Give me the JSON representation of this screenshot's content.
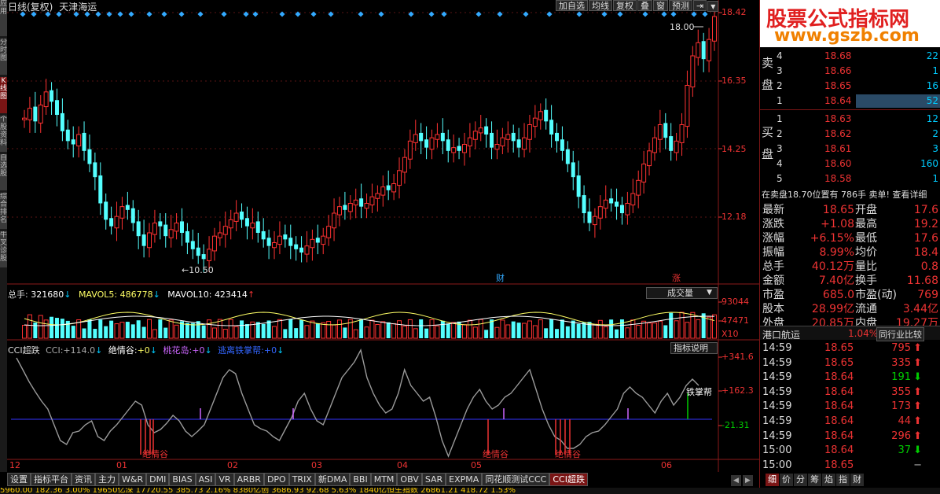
{
  "header": {
    "period": "日线(复权)",
    "stock": "天津海运"
  },
  "toolbar": [
    {
      "label": "加自选"
    },
    {
      "label": "均线"
    },
    {
      "label": "复权"
    },
    {
      "label": "叠"
    },
    {
      "label": "窗"
    },
    {
      "label": "预测"
    }
  ],
  "price_axis": [
    "18.42",
    "16.35",
    "14.25",
    "12.18"
  ],
  "annotations": {
    "high": "18.00",
    "low": "10.50",
    "cai": "财",
    "zhang": "涨"
  },
  "volume": {
    "label_total": "总手:",
    "total": "321680",
    "label_ma5": "MAVOL5:",
    "ma5": "486778",
    "label_ma10": "MAVOL10:",
    "ma10": "423414",
    "dropdown": "成交量",
    "axis_top": "93044",
    "axis_mid": "47471",
    "axis_unit": "X10"
  },
  "cci": {
    "name": "CCI超跌",
    "cci_label": "CCI:",
    "cci_val": "+114.0",
    "jqg_label": "绝情谷:",
    "jqg_val": "+0",
    "thd_label": "桃花岛:",
    "thd_val": "+0",
    "tlz_label": "逃离铁掌帮:",
    "tlz_val": "+0",
    "help_btn": "指标说明",
    "axis": [
      "+341.6",
      "+162.3",
      "-21.31"
    ],
    "marker_tzb": "铁掌帮",
    "marker_jqg": "绝情谷",
    "marker_jqg2": "绝情谷"
  },
  "dates": [
    "12",
    "01",
    "02",
    "03",
    "04",
    "05",
    "06"
  ],
  "bottom_tabs": [
    "设置",
    "指标平台",
    "资讯",
    "主力",
    "W&R",
    "DMI",
    "BIAS",
    "ASI",
    "VR",
    "ARBR",
    "DPO",
    "TRIX",
    "新DMA",
    "BBI",
    "MTM",
    "OBV",
    "SAR",
    "EXPMA",
    "同花顺测试CCC",
    "CCI超跌"
  ],
  "status_bar": "5960.00  182.36  3.00%  19650亿深  17720.55  385.73  2.16%  8380亿创  3686.93  92.68  5.63%  1840亿恒生指数  26861.21  418.72  1.53%",
  "right": {
    "banner": {
      "title": "股票公式指标网",
      "url": "www.gszb.com"
    },
    "sell_label": "卖盘",
    "buy_label": "买盘",
    "sell": [
      {
        "n": "4",
        "p": "18.68",
        "v": "22"
      },
      {
        "n": "3",
        "p": "18.66",
        "v": "1"
      },
      {
        "n": "2",
        "p": "18.65",
        "v": "16"
      },
      {
        "n": "1",
        "p": "18.64",
        "v": "52"
      }
    ],
    "buy": [
      {
        "n": "1",
        "p": "18.63",
        "v": "12"
      },
      {
        "n": "2",
        "p": "18.62",
        "v": "2"
      },
      {
        "n": "3",
        "p": "18.61",
        "v": "3"
      },
      {
        "n": "4",
        "p": "18.60",
        "v": "160"
      },
      {
        "n": "5",
        "p": "18.58",
        "v": "1"
      }
    ],
    "ticker": "在卖盘18.70位置有  786手  卖单! 查看详细",
    "stats": [
      {
        "k1": "最新",
        "v1": "18.65",
        "k2": "开盘",
        "v2": "17.6"
      },
      {
        "k1": "涨跌",
        "v1": "+1.08",
        "k2": "最高",
        "v2": "19.2"
      },
      {
        "k1": "涨幅",
        "v1": "+6.15%",
        "k2": "最低",
        "v2": "17.6"
      },
      {
        "k1": "振幅",
        "v1": "8.99%",
        "k2": "均价",
        "v2": "18.4"
      },
      {
        "k1": "总手",
        "v1": "40.12万",
        "k2": "量比",
        "v2": "0.8"
      },
      {
        "k1": "金额",
        "v1": "7.40亿",
        "k2": "换手",
        "v2": "11.68"
      },
      {
        "k1": "市盈",
        "v1": "685.0",
        "k2": "市盈(动)",
        "v2": "769"
      },
      {
        "k1": "股本",
        "v1": "28.99亿",
        "k2": "流通",
        "v2": "3.44亿"
      },
      {
        "k1": "外盘",
        "v1": "20.85万",
        "k2": "内盘",
        "v2": "19.27万"
      }
    ],
    "section": {
      "name": "港口航运",
      "pct": "1.04%",
      "btn": "同行业比较"
    },
    "ticks": [
      {
        "t": "14:59",
        "p": "18.65",
        "v": "795",
        "d": "up"
      },
      {
        "t": "14:59",
        "p": "18.65",
        "v": "335",
        "d": "up"
      },
      {
        "t": "14:59",
        "p": "18.64",
        "v": "191",
        "d": "down"
      },
      {
        "t": "14:59",
        "p": "18.64",
        "v": "355",
        "d": "up"
      },
      {
        "t": "14:59",
        "p": "18.64",
        "v": "173",
        "d": "up"
      },
      {
        "t": "14:59",
        "p": "18.64",
        "v": "44",
        "d": "up"
      },
      {
        "t": "14:59",
        "p": "18.64",
        "v": "296",
        "d": "up"
      },
      {
        "t": "15:00",
        "p": "18.64",
        "v": "37",
        "d": "down"
      },
      {
        "t": "15:00",
        "p": "18.65",
        "v": "",
        "d": "none"
      }
    ],
    "tabs": [
      "细",
      "价",
      "分",
      "筹",
      "焰",
      "指",
      "财"
    ]
  },
  "left_tabs": [
    "应用",
    "分时图",
    "K线图",
    "个股资料",
    "自选股",
    "综合排名",
    "牛叉诊股"
  ]
}
